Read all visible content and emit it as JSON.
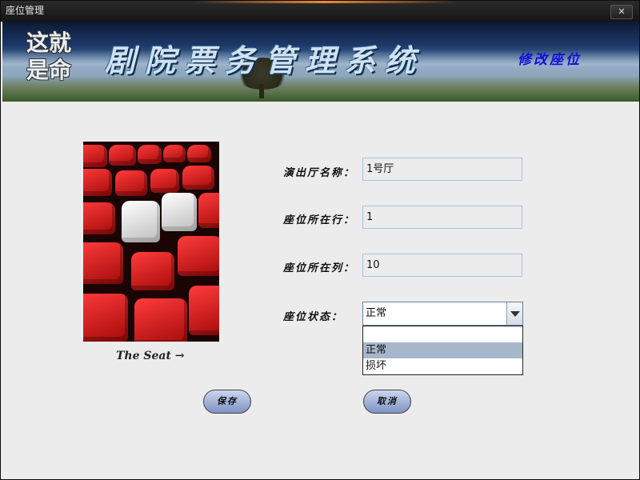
{
  "window": {
    "title": "座位管理",
    "close_label": "✕"
  },
  "banner": {
    "logo_text": "这就是命",
    "app_title": "剧院票务管理系统",
    "subtitle": "修改座位"
  },
  "photo": {
    "caption": "The Seat →"
  },
  "form": {
    "hall_label": "演出厅名称：",
    "hall_value": "1号厅",
    "row_label": "座位所在行：",
    "row_value": "1",
    "col_label": "座位所在列：",
    "col_value": "10",
    "status_label": "座位状态：",
    "status_value": "正常",
    "status_options": [
      "",
      "正常",
      "损坏"
    ]
  },
  "buttons": {
    "save_label": "保存",
    "cancel_label": "取消"
  }
}
